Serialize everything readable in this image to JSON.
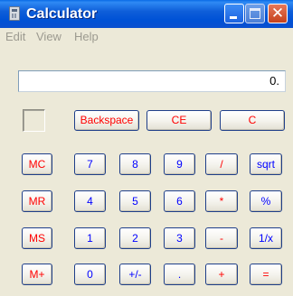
{
  "window": {
    "title": "Calculator"
  },
  "menu": {
    "items": [
      "Edit",
      "View",
      "Help"
    ]
  },
  "display": {
    "value": "0."
  },
  "buttons": {
    "backspace": "Backspace",
    "ce": "CE",
    "c": "C",
    "mc": "MC",
    "mr": "MR",
    "ms": "MS",
    "mplus": "M+",
    "n7": "7",
    "n8": "8",
    "n9": "9",
    "div": "/",
    "sqrt": "sqrt",
    "n4": "4",
    "n5": "5",
    "n6": "6",
    "mul": "*",
    "pct": "%",
    "n1": "1",
    "n2": "2",
    "n3": "3",
    "sub": "-",
    "recip": "1/x",
    "n0": "0",
    "sign": "+/-",
    "dot": ".",
    "add": "+",
    "eq": "="
  },
  "colors": {
    "title_bar": "#0052d6",
    "operator_text": "#ff0000",
    "digit_text": "#0000ff",
    "menu_text_disabled": "#9c9a90"
  },
  "icons": {
    "app": "calculator-icon",
    "minimize": "minimize-icon",
    "maximize": "maximize-icon",
    "close": "close-icon"
  }
}
